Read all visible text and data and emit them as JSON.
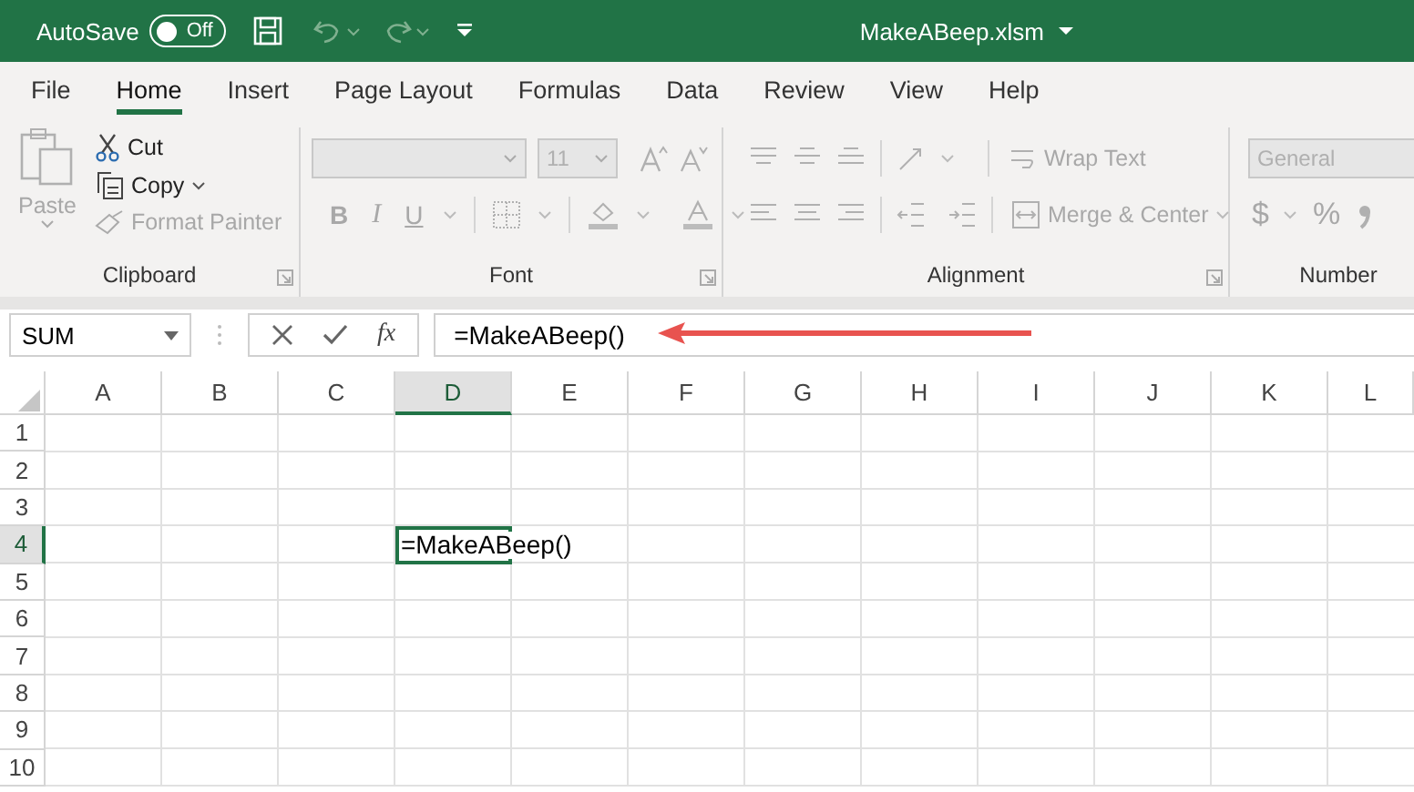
{
  "title_bar": {
    "autosave_label": "AutoSave",
    "autosave_toggle": {
      "label": "Off",
      "on": false
    },
    "file_name": "MakeABeep.xlsm"
  },
  "tabs": [
    {
      "label": "File",
      "selected": false
    },
    {
      "label": "Home",
      "selected": true
    },
    {
      "label": "Insert",
      "selected": false
    },
    {
      "label": "Page Layout",
      "selected": false
    },
    {
      "label": "Formulas",
      "selected": false
    },
    {
      "label": "Data",
      "selected": false
    },
    {
      "label": "Review",
      "selected": false
    },
    {
      "label": "View",
      "selected": false
    },
    {
      "label": "Help",
      "selected": false
    }
  ],
  "ribbon": [
    {
      "kind": "clipboard",
      "label": "Clipboard",
      "paste": {
        "label": "Paste",
        "disabled": true
      },
      "cut": {
        "label": "Cut",
        "disabled": false
      },
      "copy": {
        "label": "Copy",
        "disabled": false
      },
      "format_painter": {
        "label": "Format Painter",
        "disabled": true
      }
    },
    {
      "kind": "font",
      "label": "Font",
      "disabled": true,
      "font_size": "11",
      "bold": "B",
      "italic": "I",
      "underline": "U"
    },
    {
      "kind": "alignment",
      "label": "Alignment",
      "disabled": true,
      "wrap_text": "Wrap Text",
      "merge_center": "Merge & Center"
    },
    {
      "kind": "number",
      "label": "Number",
      "disabled": true,
      "format": "General",
      "currency": "$",
      "percent": "%"
    }
  ],
  "formula_bar": {
    "name_box": "SUM",
    "function_label": "fx",
    "formula": "=MakeABeep()"
  },
  "grid": {
    "columns": [
      {
        "label": "A",
        "selected": false
      },
      {
        "label": "B",
        "selected": false
      },
      {
        "label": "C",
        "selected": false
      },
      {
        "label": "D",
        "selected": true
      },
      {
        "label": "E",
        "selected": false
      },
      {
        "label": "F",
        "selected": false
      },
      {
        "label": "G",
        "selected": false
      },
      {
        "label": "H",
        "selected": false
      },
      {
        "label": "I",
        "selected": false
      },
      {
        "label": "J",
        "selected": false
      },
      {
        "label": "K",
        "selected": false
      },
      {
        "label": "L",
        "selected": false
      }
    ],
    "rows": [
      {
        "label": "1",
        "selected": false
      },
      {
        "label": "2",
        "selected": false
      },
      {
        "label": "3",
        "selected": false
      },
      {
        "label": "4",
        "selected": true
      },
      {
        "label": "5",
        "selected": false
      },
      {
        "label": "6",
        "selected": false
      },
      {
        "label": "7",
        "selected": false
      },
      {
        "label": "8",
        "selected": false
      },
      {
        "label": "9",
        "selected": false
      },
      {
        "label": "10",
        "selected": false
      }
    ],
    "active_cell": {
      "text": "=MakeABeep()"
    }
  }
}
